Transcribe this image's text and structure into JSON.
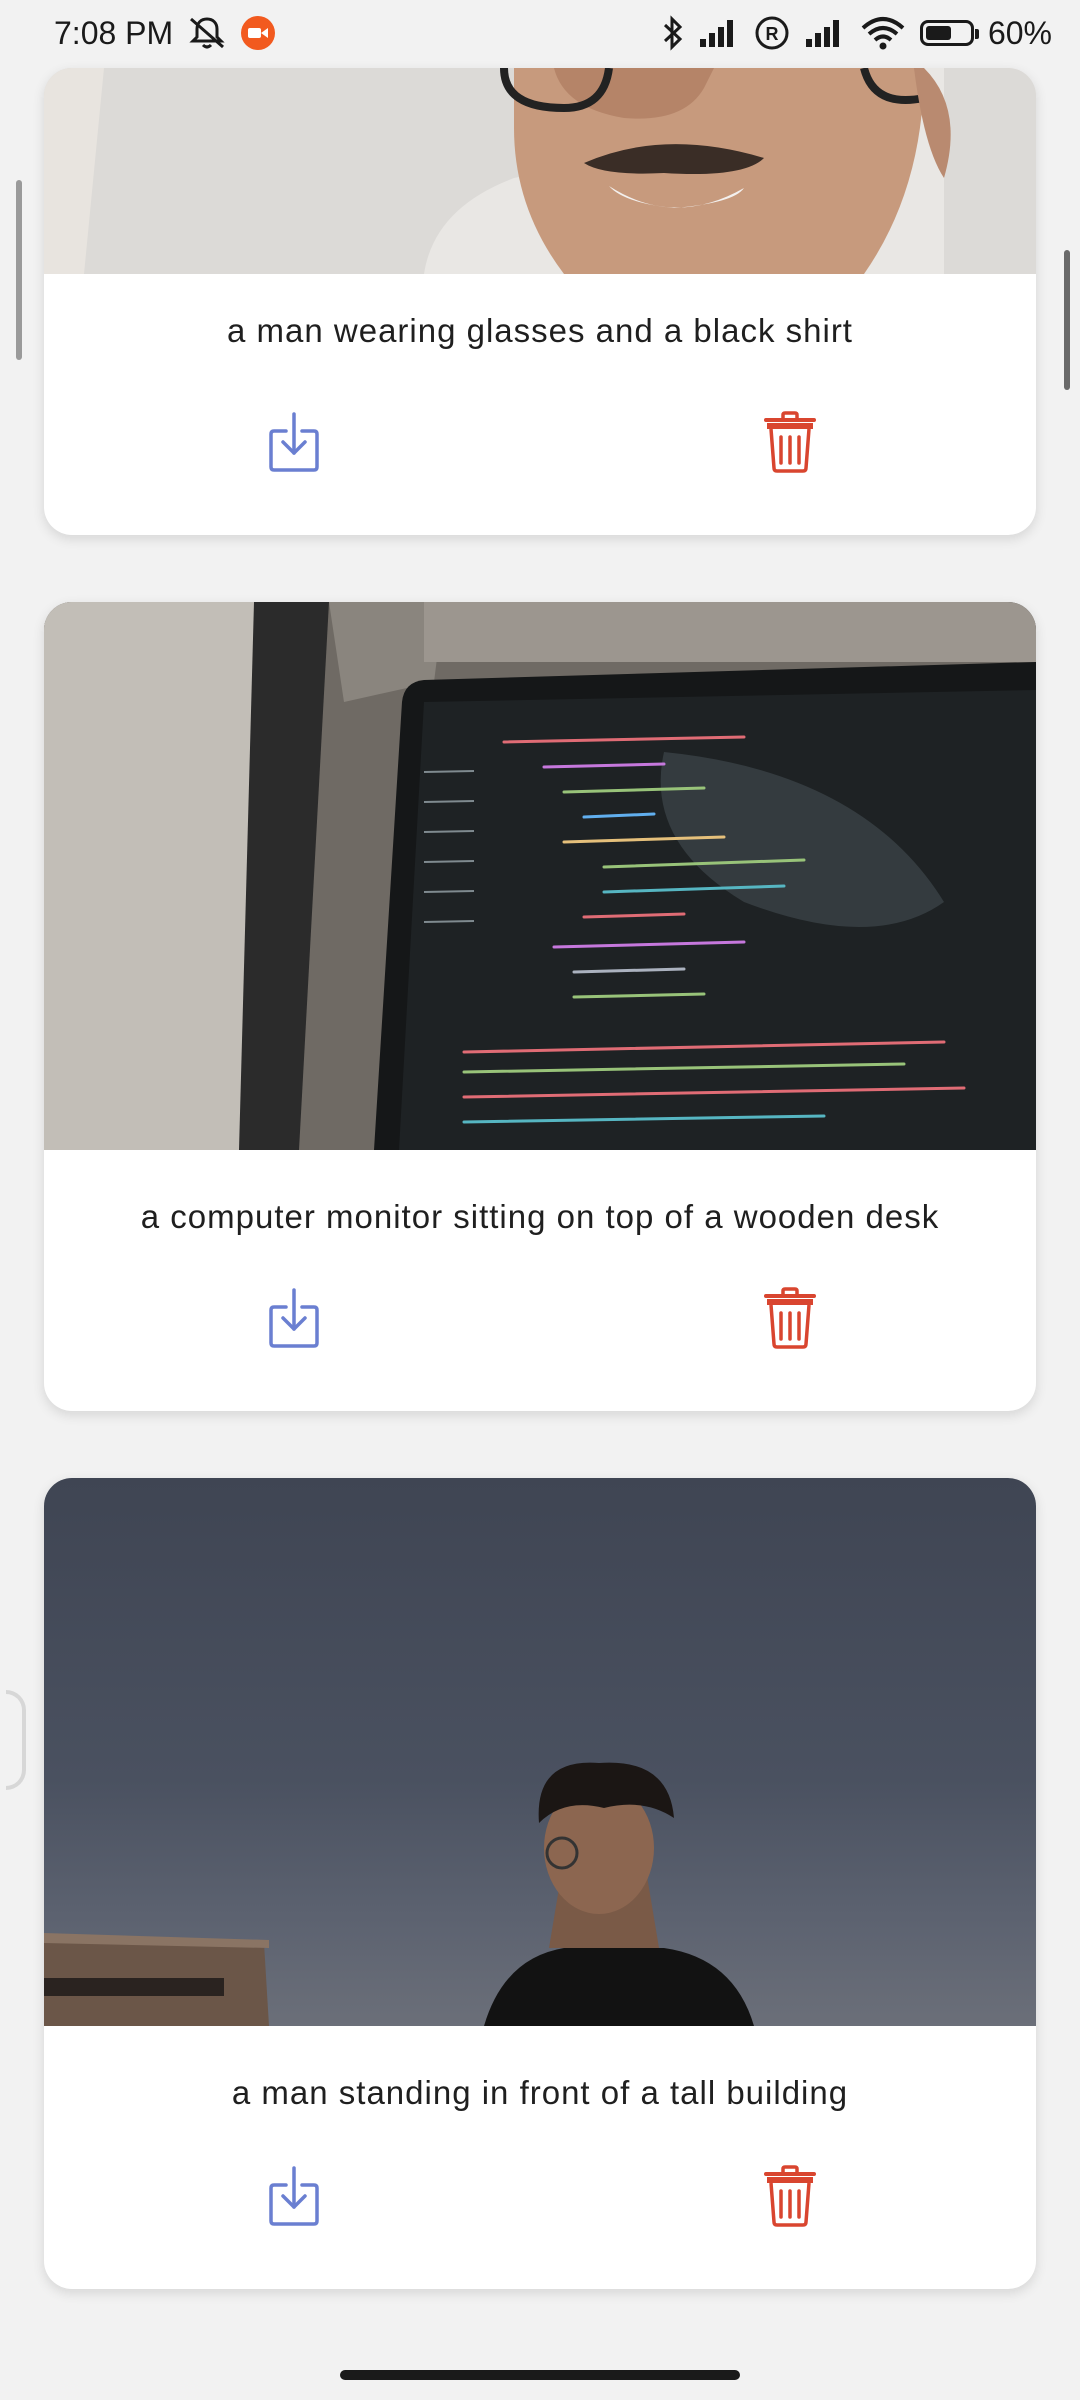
{
  "status_bar": {
    "time": "7:08 PM",
    "battery_percent": "60%",
    "battery_level": 0.6,
    "icons": [
      "mute-icon",
      "screen-record-icon",
      "bluetooth-icon",
      "signal-icon",
      "roaming-icon",
      "signal-icon",
      "wifi-icon",
      "battery-icon"
    ]
  },
  "cards": [
    {
      "caption": "a man wearing glasses and a black shirt",
      "image": "selfie-photo"
    },
    {
      "caption": "a computer monitor sitting on top of a wooden desk",
      "image": "monitor-code-photo"
    },
    {
      "caption": "a man standing in front of a tall building",
      "image": "night-portrait-photo"
    }
  ],
  "colors": {
    "download": "#6a7fd1",
    "delete": "#d9452f",
    "card_bg": "#ffffff",
    "page_bg": "#f2f2f2",
    "recording": "#f25a1f"
  }
}
